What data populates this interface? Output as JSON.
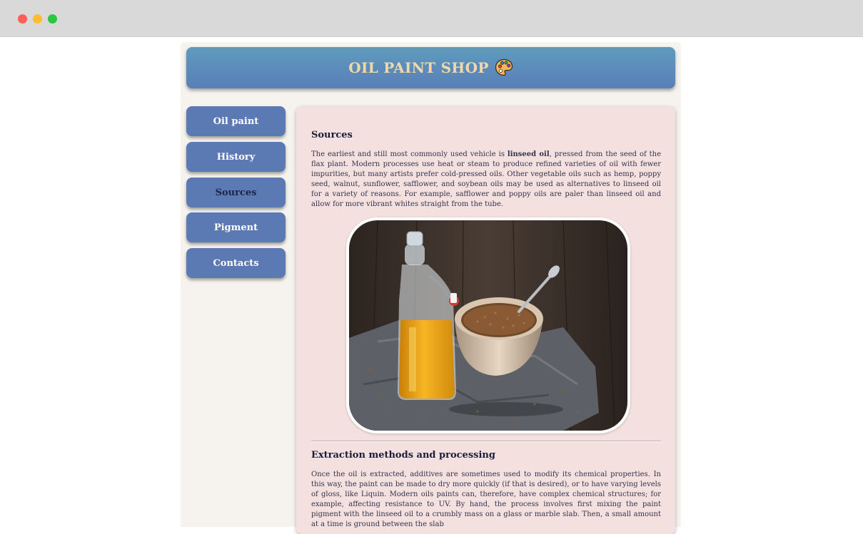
{
  "browser": {
    "window_controls": [
      "close",
      "minimize",
      "maximize"
    ]
  },
  "header": {
    "title": "OIL PAINT SHOP",
    "icon": "palette-icon"
  },
  "nav": {
    "items": [
      {
        "label": "Oil paint",
        "active": false
      },
      {
        "label": "History",
        "active": false
      },
      {
        "label": "Sources",
        "active": true
      },
      {
        "label": "Pigment",
        "active": false
      },
      {
        "label": "Contacts",
        "active": false
      }
    ]
  },
  "main": {
    "section1": {
      "heading": "Sources",
      "para_intro": "The earliest and still most commonly used vehicle is ",
      "para_bold": "linseed oil",
      "para_rest": ", pressed from the seed of the flax plant. Modern processes use heat or steam to produce refined varieties of oil with fewer impurities, but many artists prefer cold-pressed oils. Other vegetable oils such as hemp, poppy seed, walnut, sunflower, safflower, and soybean oils may be used as alternatives to linseed oil for a variety of reasons. For example, safflower and poppy oils are paler than linseed oil and allow for more vibrant whites straight from the tube."
    },
    "image": {
      "subject": "linseed-oil-bottle-and-flax-seeds-photo"
    },
    "section2": {
      "heading": "Extraction methods and processing",
      "paragraph": "Once the oil is extracted, additives are sometimes used to modify its chemical properties. In this way, the paint can be made to dry more quickly (if that is desired), or to have varying levels of gloss, like Liquin. Modern oils paints can, therefore, have complex chemical structures; for example, affecting resistance to UV. By hand, the process involves first mixing the paint pigment with the linseed oil to a crumbly mass on a glass or marble slab. Then, a small amount at a time is ground between the slab"
    }
  },
  "colors": {
    "header_gradient_top": "#5e9bbe",
    "header_gradient_bottom": "#5a7fb7",
    "header_text": "#f1d8a7",
    "nav_button": "#5b79b2",
    "nav_active_text": "#1f2547",
    "content_bg": "#f4e1df",
    "page_bg": "#f6f3ee"
  }
}
